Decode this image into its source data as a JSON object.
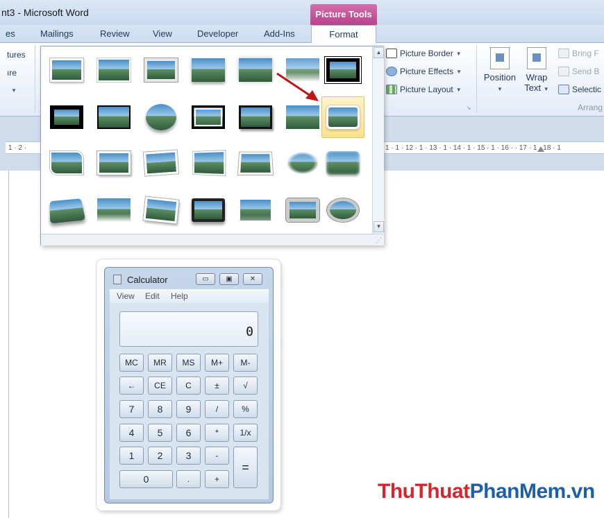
{
  "window": {
    "title": "nt3 - Microsoft Word",
    "contextual_header": "Picture Tools"
  },
  "tabs": [
    {
      "label": "es"
    },
    {
      "label": "Mailings"
    },
    {
      "label": "Review"
    },
    {
      "label": "View"
    },
    {
      "label": "Developer"
    },
    {
      "label": "Add-Ins"
    },
    {
      "label": "Format",
      "active": true
    }
  ],
  "ribbon": {
    "left_partial": {
      "line1": "tures",
      "line2": "ıre"
    },
    "picture_styles": {
      "border": "Picture Border",
      "effects": "Picture Effects",
      "layout": "Picture Layout"
    },
    "arrange": {
      "position": "Position",
      "wrap_line1": "Wrap",
      "wrap_line2": "Text",
      "bring_forward": "Bring F",
      "send_backward": "Send B",
      "selection": "Selectic",
      "group_label": "Arrang"
    }
  },
  "ruler": {
    "left_text": "1 · 2 ·",
    "right_text": "1 · 1 · 12 · 1 · 13 · 1 · 14 · 1 · 15 · 1 · 16 ·   · 17 · 1 · 18 · 1"
  },
  "gallery": {
    "selected_index": 13
  },
  "calculator": {
    "title": "Calculator",
    "menu": {
      "view": "View",
      "edit": "Edit",
      "help": "Help"
    },
    "display": "0",
    "keys": {
      "mc": "MC",
      "mr": "MR",
      "ms": "MS",
      "mplus": "M+",
      "mminus": "M-",
      "back": "←",
      "ce": "CE",
      "c": "C",
      "plusminus": "±",
      "sqrt": "√",
      "k7": "7",
      "k8": "8",
      "k9": "9",
      "div": "/",
      "pct": "%",
      "k4": "4",
      "k5": "5",
      "k6": "6",
      "mul": "*",
      "recip": "1/x",
      "k1": "1",
      "k2": "2",
      "k3": "3",
      "minus": "-",
      "eq": "=",
      "k0": "0",
      "dot": ".",
      "plus": "+"
    }
  },
  "watermark": {
    "part1": "ThuThuat",
    "part2": "PhanMem.vn"
  },
  "colors": {
    "contextual_tab": "#c4559a",
    "arrow": "#c0141b",
    "watermark_red": "#d8252d",
    "watermark_blue": "#1f5fa8"
  }
}
